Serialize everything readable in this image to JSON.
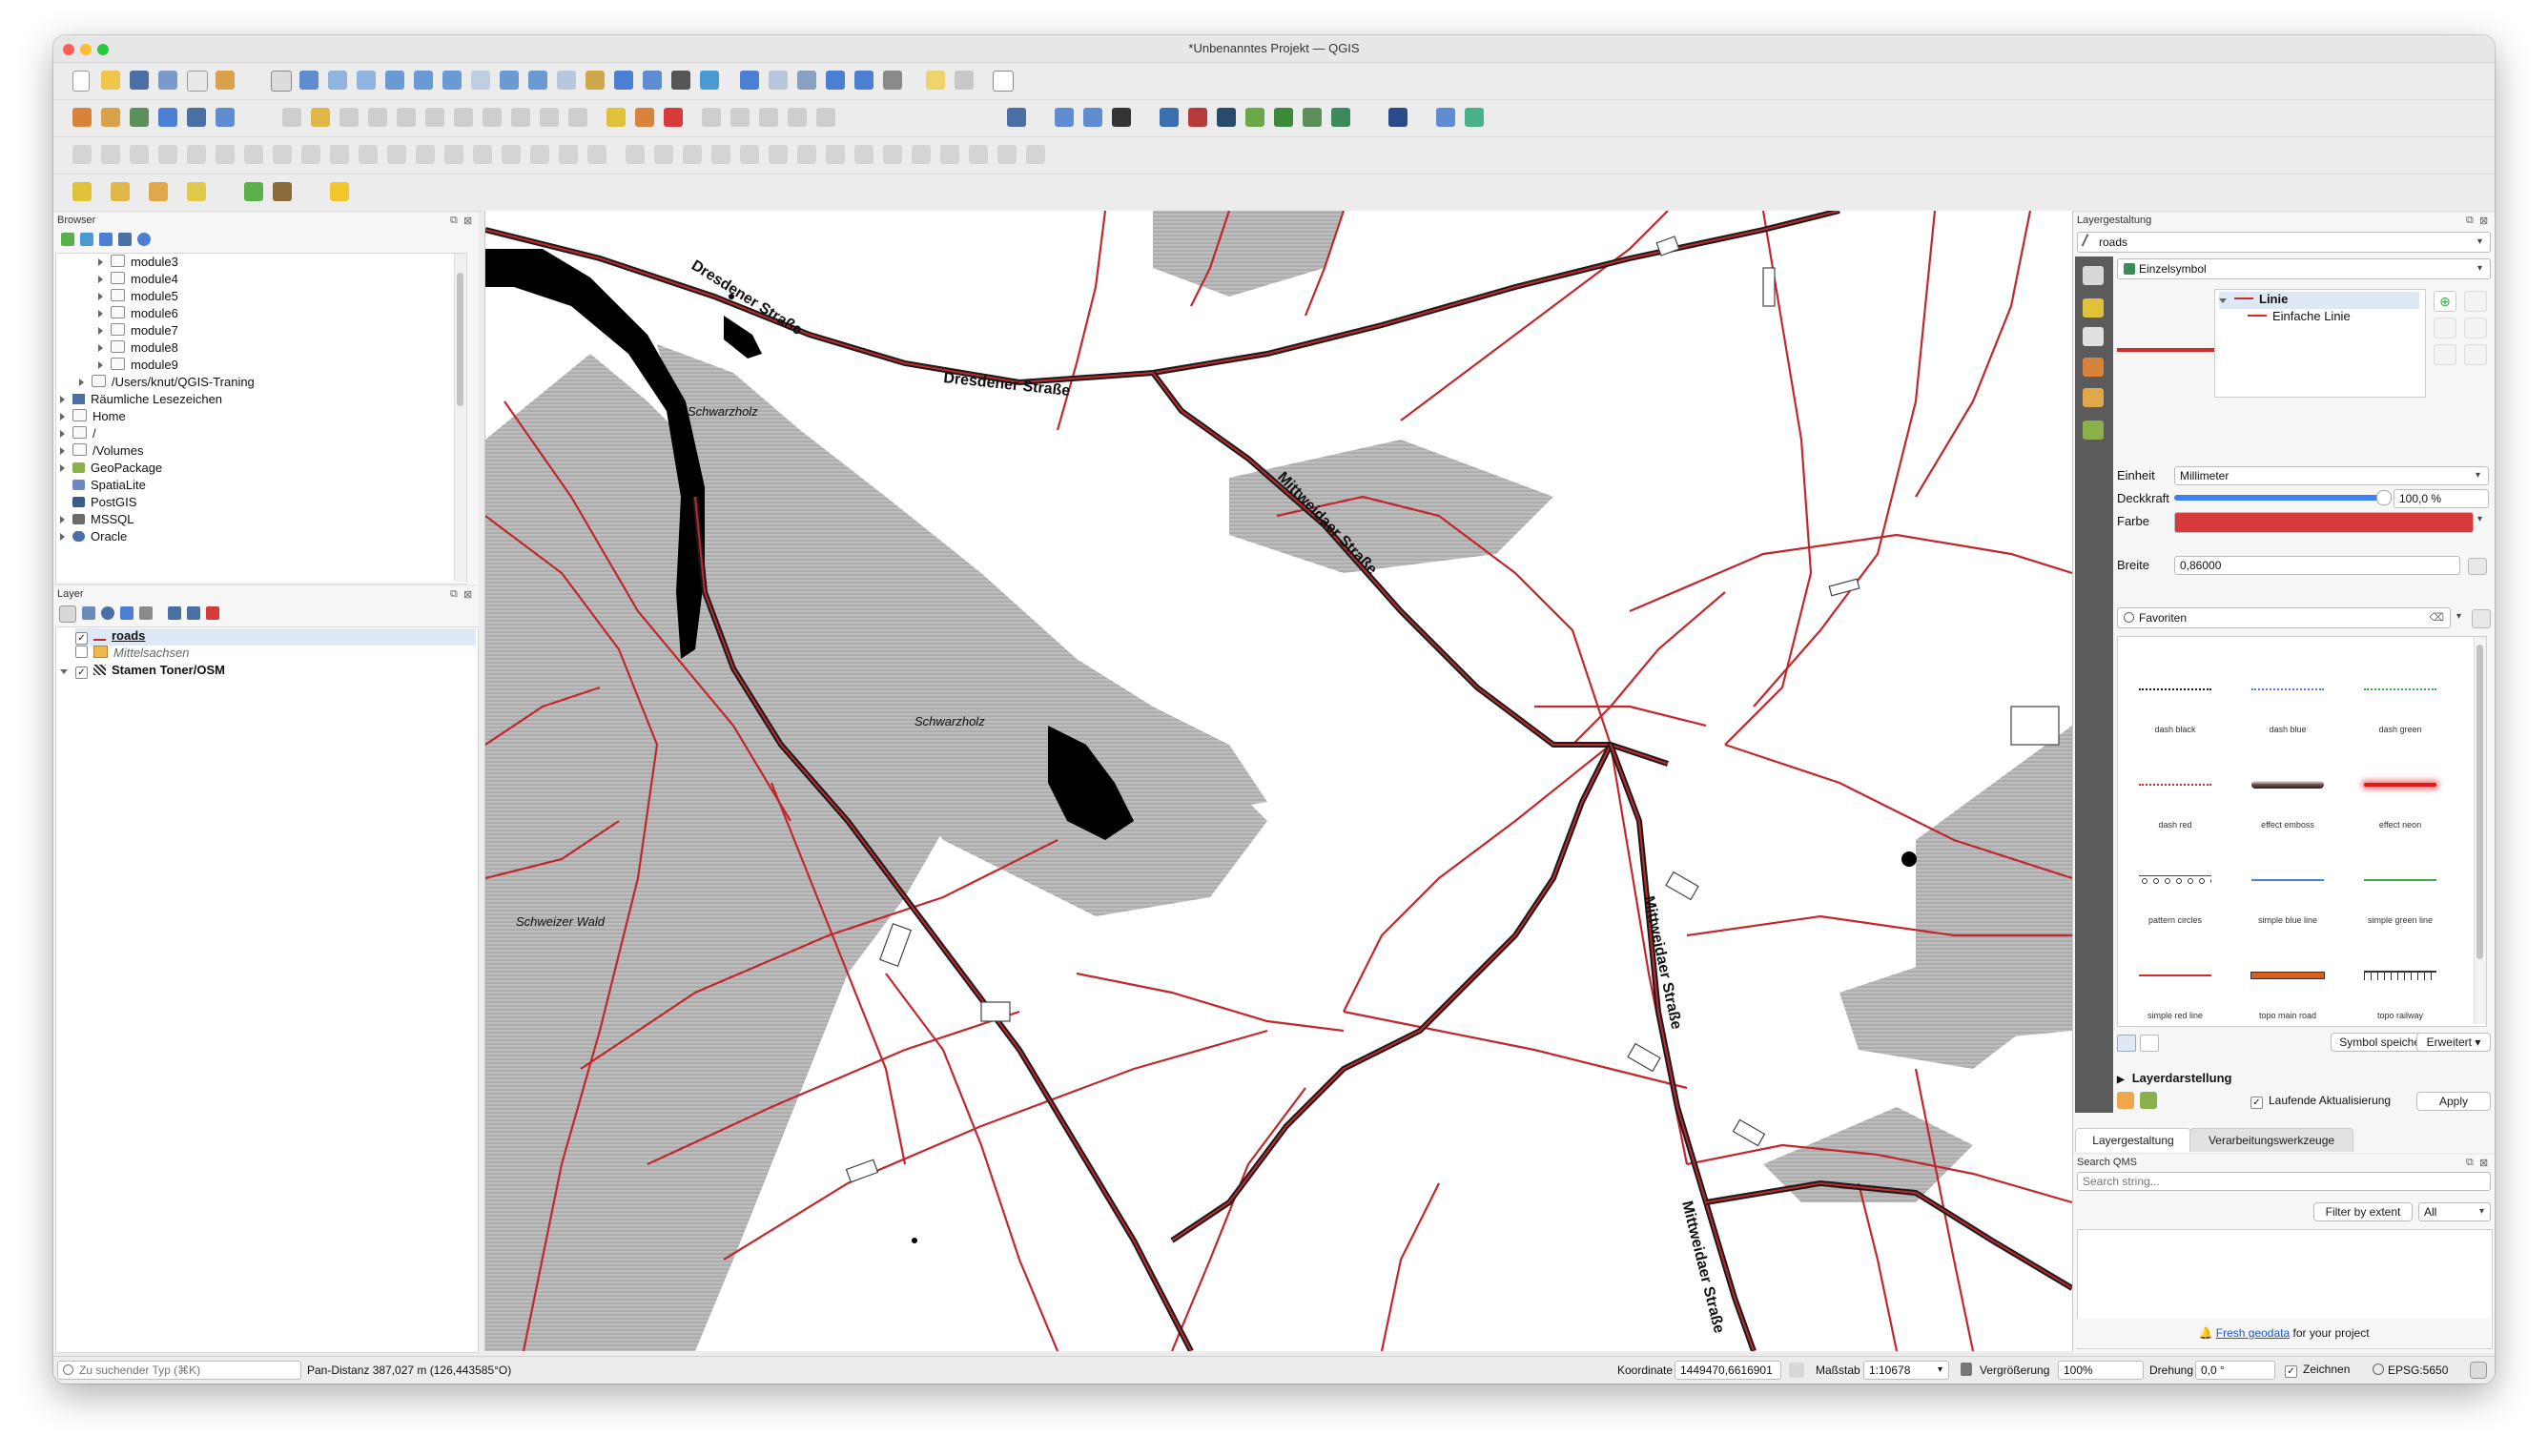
{
  "window": {
    "title": "*Unbenanntes Projekt — QGIS"
  },
  "browser": {
    "title": "Browser",
    "items": [
      {
        "label": "module3"
      },
      {
        "label": "module4"
      },
      {
        "label": "module5"
      },
      {
        "label": "module6"
      },
      {
        "label": "module7"
      },
      {
        "label": "module8"
      },
      {
        "label": "module9"
      },
      {
        "label": "/Users/knut/QGIS-Traning"
      },
      {
        "label": "Räumliche Lesezeichen"
      },
      {
        "label": "Home"
      },
      {
        "label": "/"
      },
      {
        "label": "/Volumes"
      },
      {
        "label": "GeoPackage"
      },
      {
        "label": "SpatiaLite"
      },
      {
        "label": "PostGIS"
      },
      {
        "label": "MSSQL"
      },
      {
        "label": "Oracle"
      }
    ]
  },
  "layers": {
    "title": "Layer",
    "items": [
      {
        "label": "roads",
        "checked": true
      },
      {
        "label": "Mittelsachsen",
        "checked": false
      },
      {
        "label": "Stamen Toner/OSM",
        "checked": true
      }
    ]
  },
  "map": {
    "labels": [
      "Dresdener Straße",
      "Dresdener Straße",
      "Mittweidaer Straße",
      "Schwarzholz",
      "Schwarzholz",
      "Schweizer Wald",
      "Mittweidaer Straße",
      "Mittweidaer Straße"
    ],
    "road_color": "#c0282d",
    "main_road_color": "#1a1a1a"
  },
  "styling": {
    "title": "Layergestaltung",
    "layer_select": "roads",
    "renderer": "Einzelsymbol",
    "tree": {
      "root": "Linie",
      "child": "Einfache Linie"
    },
    "unit_label": "Einheit",
    "unit_value": "Millimeter",
    "opacity_label": "Deckkraft",
    "opacity_value": "100,0 %",
    "opacity_fraction": 1.0,
    "color_label": "Farbe",
    "color_value": "#d63a3a",
    "width_label": "Breite",
    "width_value": "0,86000",
    "favorites_placeholder": "Favoriten",
    "symbols": [
      {
        "name": "dash  black",
        "color": "#222222",
        "style": "dotted"
      },
      {
        "name": "dash blue",
        "color": "#4a7fd4",
        "style": "dotted"
      },
      {
        "name": "dash green",
        "color": "#3aa846",
        "style": "dotted"
      },
      {
        "name": "dash red",
        "color": "#d22b2b",
        "style": "dotted"
      },
      {
        "name": "effect emboss",
        "color": "#6b4a48",
        "style": "emboss"
      },
      {
        "name": "effect neon",
        "color": "#e01818",
        "style": "neon"
      },
      {
        "name": "pattern circles",
        "color": "#444444",
        "style": "circles"
      },
      {
        "name": "simple blue line",
        "color": "#4a7fd4",
        "style": "solid"
      },
      {
        "name": "simple green line",
        "color": "#3aa846",
        "style": "solid"
      },
      {
        "name": "simple red line",
        "color": "#d22b2b",
        "style": "solid"
      },
      {
        "name": "topo main road",
        "color": "#d95d1e",
        "style": "thick"
      },
      {
        "name": "topo railway",
        "color": "#333333",
        "style": "rail"
      }
    ],
    "save_symbol": "Symbol speichern...",
    "advanced": "Erweitert",
    "layer_rendering": "Layerdarstellung",
    "live_update": "Laufende Aktualisierung",
    "apply": "Apply",
    "tabs": [
      "Layergestaltung",
      "Verarbeitungswerkzeuge"
    ]
  },
  "qms": {
    "title": "Search QMS",
    "placeholder": "Search string...",
    "filter_button": "Filter by extent",
    "filter_value": "All",
    "footer_link": "Fresh geodata",
    "footer_text": " for your project"
  },
  "statusbar": {
    "search_placeholder": "Zu suchender Typ (⌘K)",
    "message": "Pan-Distanz 387,027 m (126,443585°O)",
    "coord_label": "Koordinate",
    "coord_value": "1449470,6616901",
    "scale_label": "Maßstab",
    "scale_value": "1:10678",
    "magnifier_label": "Vergrößerung",
    "magnifier_value": "100%",
    "rotation_label": "Drehung",
    "rotation_value": "0,0 °",
    "render_label": "Zeichnen",
    "crs": "EPSG:5650"
  },
  "colors": {
    "accent": "#3b82f6",
    "close": "#fe5f57",
    "minimize": "#febc2e",
    "zoom": "#28c840"
  }
}
